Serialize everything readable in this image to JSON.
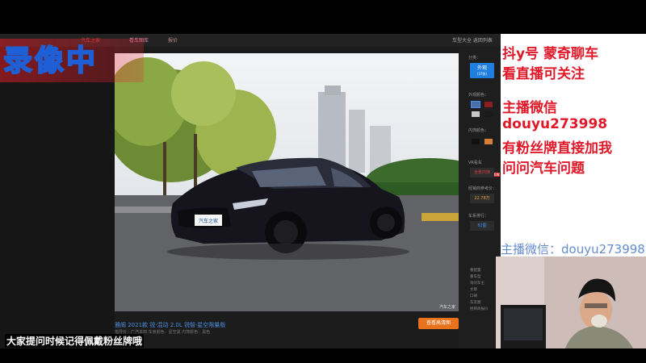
{
  "overlay": {
    "recording_label": "录像中",
    "info_lines": [
      "抖y号  蒙奇聊车",
      "看直播可关注",
      "主播微信",
      "douyu273998",
      "有粉丝牌直接加我",
      "问问汽车问题"
    ],
    "ghost_text": "主播微信：douyu273998",
    "subtitle": "大家提问时候记得佩戴粉丝牌哦"
  },
  "browser": {
    "topbar": [
      "汽车之家",
      "看车图库",
      "报价",
      "车型大全 返回列表"
    ],
    "photo_watermark": "汽车之家",
    "plate_text": "汽车之家",
    "car_title": "雅阁  2021款 锐·混动 2.0L 锐智·星空限量版",
    "car_subtitle": "指导价：广汽本田  车身颜色：星空黑  内饰颜色：黑色",
    "hd_button": "查看高清图",
    "sidebar": {
      "category_label": "分类：",
      "exterior_button": "外观",
      "exterior_count": "(37张)",
      "exterior_color_label": "外观颜色：",
      "interior_color_label": "内饰颜色：",
      "vr_label": "VR看车",
      "vr_value": "全景内饰",
      "new_badge": "NEW",
      "price_label": "经销商参考价：",
      "price_value": "22.78万",
      "series_label": "车系排行：",
      "series_value": "82图",
      "links": [
        "看配置",
        "看车型",
        "询问车主",
        "文章",
        "口碑",
        "车友圈",
        "经销商报价"
      ]
    },
    "colors": {
      "exterior": [
        "#4a6fa8",
        "#8b1e22",
        "#c8c8c8",
        "#1a1a1a"
      ],
      "interior": [
        "#111111",
        "#d4803a"
      ]
    }
  }
}
